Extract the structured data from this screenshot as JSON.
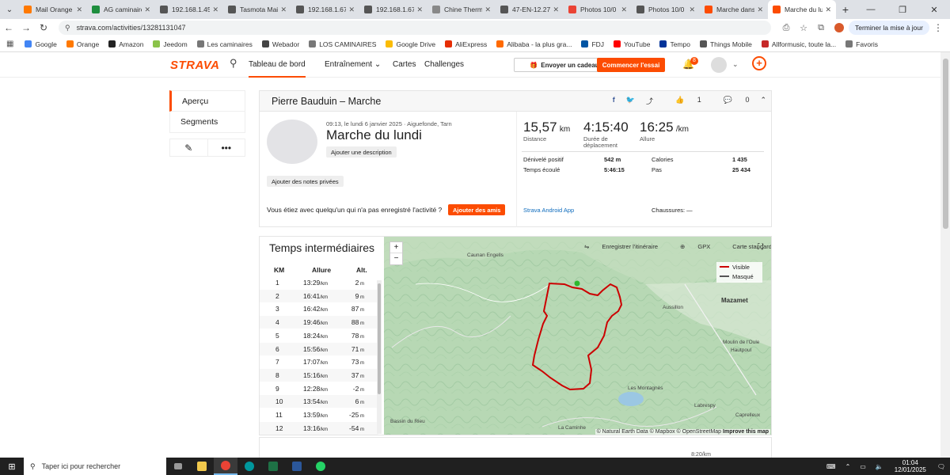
{
  "browser": {
    "tabs": [
      {
        "label": "Mail Orange",
        "color": "#ff7900"
      },
      {
        "label": "AG caminaires",
        "color": "#1e8e3e"
      },
      {
        "label": "192.168.1.45",
        "color": "#555555"
      },
      {
        "label": "Tasmota Main",
        "color": "#555555"
      },
      {
        "label": "192.168.1.67",
        "color": "#555555"
      },
      {
        "label": "192.168.1.67",
        "color": "#555555"
      },
      {
        "label": "Chine Thermo",
        "color": "#888888"
      },
      {
        "label": "47-EN-12.27",
        "color": "#555555"
      },
      {
        "label": "Photos 10/0",
        "color": "#ea4335"
      },
      {
        "label": "Photos 10/0",
        "color": "#555555"
      },
      {
        "label": "Marche dans",
        "color": "#fc4c02"
      },
      {
        "label": "Marche du lu",
        "color": "#fc4c02"
      }
    ],
    "url": "strava.com/activities/13281131047",
    "update_label": "Terminer la mise à jour",
    "bookmarks": [
      {
        "label": "Google",
        "color": "#4285f4"
      },
      {
        "label": "Orange",
        "color": "#ff7900"
      },
      {
        "label": "Amazon",
        "color": "#222222"
      },
      {
        "label": "Jeedom",
        "color": "#8bc34a"
      },
      {
        "label": "Les caminaires",
        "color": "#777777"
      },
      {
        "label": "Webador",
        "color": "#444444"
      },
      {
        "label": "LOS CAMINAIRES",
        "color": "#777777"
      },
      {
        "label": "Google Drive",
        "color": "#fbbc04"
      },
      {
        "label": "AliExpress",
        "color": "#e62e04"
      },
      {
        "label": "Alibaba - la plus gra...",
        "color": "#ff6a00"
      },
      {
        "label": "FDJ",
        "color": "#0055a4"
      },
      {
        "label": "YouTube",
        "color": "#ff0000"
      },
      {
        "label": "Tempo",
        "color": "#003399"
      },
      {
        "label": "Things Mobile",
        "color": "#555555"
      },
      {
        "label": "Allformusic, toute la...",
        "color": "#c62828"
      },
      {
        "label": "Favoris",
        "color": "#777777"
      }
    ]
  },
  "header": {
    "logo": "STRAVA",
    "nav": [
      "Tableau de bord",
      "Entraînement",
      "Cartes",
      "Challenges"
    ],
    "gift_label": "Envoyer un cadeau",
    "trial_label": "Commencer l'essai",
    "notif_count": "8"
  },
  "sidebar": {
    "items": [
      "Aperçu",
      "Segments"
    ]
  },
  "activity": {
    "athlete_title": "Pierre Bauduin – Marche",
    "kudos": "1",
    "comments": "0",
    "date": "09:13, le lundi 6 janvier 2025 · Aiguefonde, Tarn",
    "title": "Marche du lundi",
    "add_description": "Ajouter une description",
    "add_notes": "Ajouter des notes privées",
    "friends_question": "Vous étiez avec quelqu'un qui n'a pas enregistré l'activité ?",
    "add_friends": "Ajouter des amis",
    "stats": {
      "distance_value": "15,57",
      "distance_unit": "km",
      "distance_label": "Distance",
      "moving_time_value": "4:15:40",
      "moving_time_label": "Durée de déplacement",
      "pace_value": "16:25",
      "pace_unit": "/km",
      "pace_label": "Allure",
      "elev_label": "Dénivelé positif",
      "elev_value": "542 m",
      "elapsed_label": "Temps écoulé",
      "elapsed_value": "5:46:15",
      "calories_label": "Calories",
      "calories_value": "1 435",
      "steps_label": "Pas",
      "steps_value": "25 434",
      "device": "Strava Android App",
      "shoes": "Chaussures: —"
    }
  },
  "splits": {
    "title": "Temps intermédiaires",
    "headers": [
      "KM",
      "Allure",
      "Alt."
    ],
    "rows": [
      [
        "1",
        "13:29",
        "2"
      ],
      [
        "2",
        "16:41",
        "9"
      ],
      [
        "3",
        "16:42",
        "87"
      ],
      [
        "4",
        "19:46",
        "88"
      ],
      [
        "5",
        "18:24",
        "78"
      ],
      [
        "6",
        "15:56",
        "71"
      ],
      [
        "7",
        "17:07",
        "73"
      ],
      [
        "8",
        "15:16",
        "37"
      ],
      [
        "9",
        "12:28",
        "-2"
      ],
      [
        "10",
        "13:54",
        "6"
      ],
      [
        "11",
        "13:59",
        "-25"
      ],
      [
        "12",
        "13:16",
        "-54"
      ]
    ],
    "pace_unit": "/km",
    "alt_unit": "m"
  },
  "map": {
    "save_route": "Enregistrer l'itinéraire",
    "gpx": "GPX",
    "style": "Carte standard",
    "legend_visible": "Visible",
    "legend_hidden": "Masqué",
    "labels": [
      "Caunan Engells",
      "Aussillon",
      "Mazamet",
      "Moulin de l'Oule",
      "Hautpoul",
      "Les Montagnès",
      "Labrespy",
      "Caprelleux",
      "La Caminhe",
      "Bassin du Rieu"
    ],
    "attribution": "© Natural Earth Data © Mapbox © OpenStreetMap",
    "improve": "Improve this map",
    "route_color": "#cc0000"
  },
  "chart_footer": {
    "pace_axis_label": "8:20/km"
  },
  "taskbar": {
    "search_placeholder": "Taper ici pour rechercher",
    "time": "01:04",
    "date": "12/01/2025"
  }
}
